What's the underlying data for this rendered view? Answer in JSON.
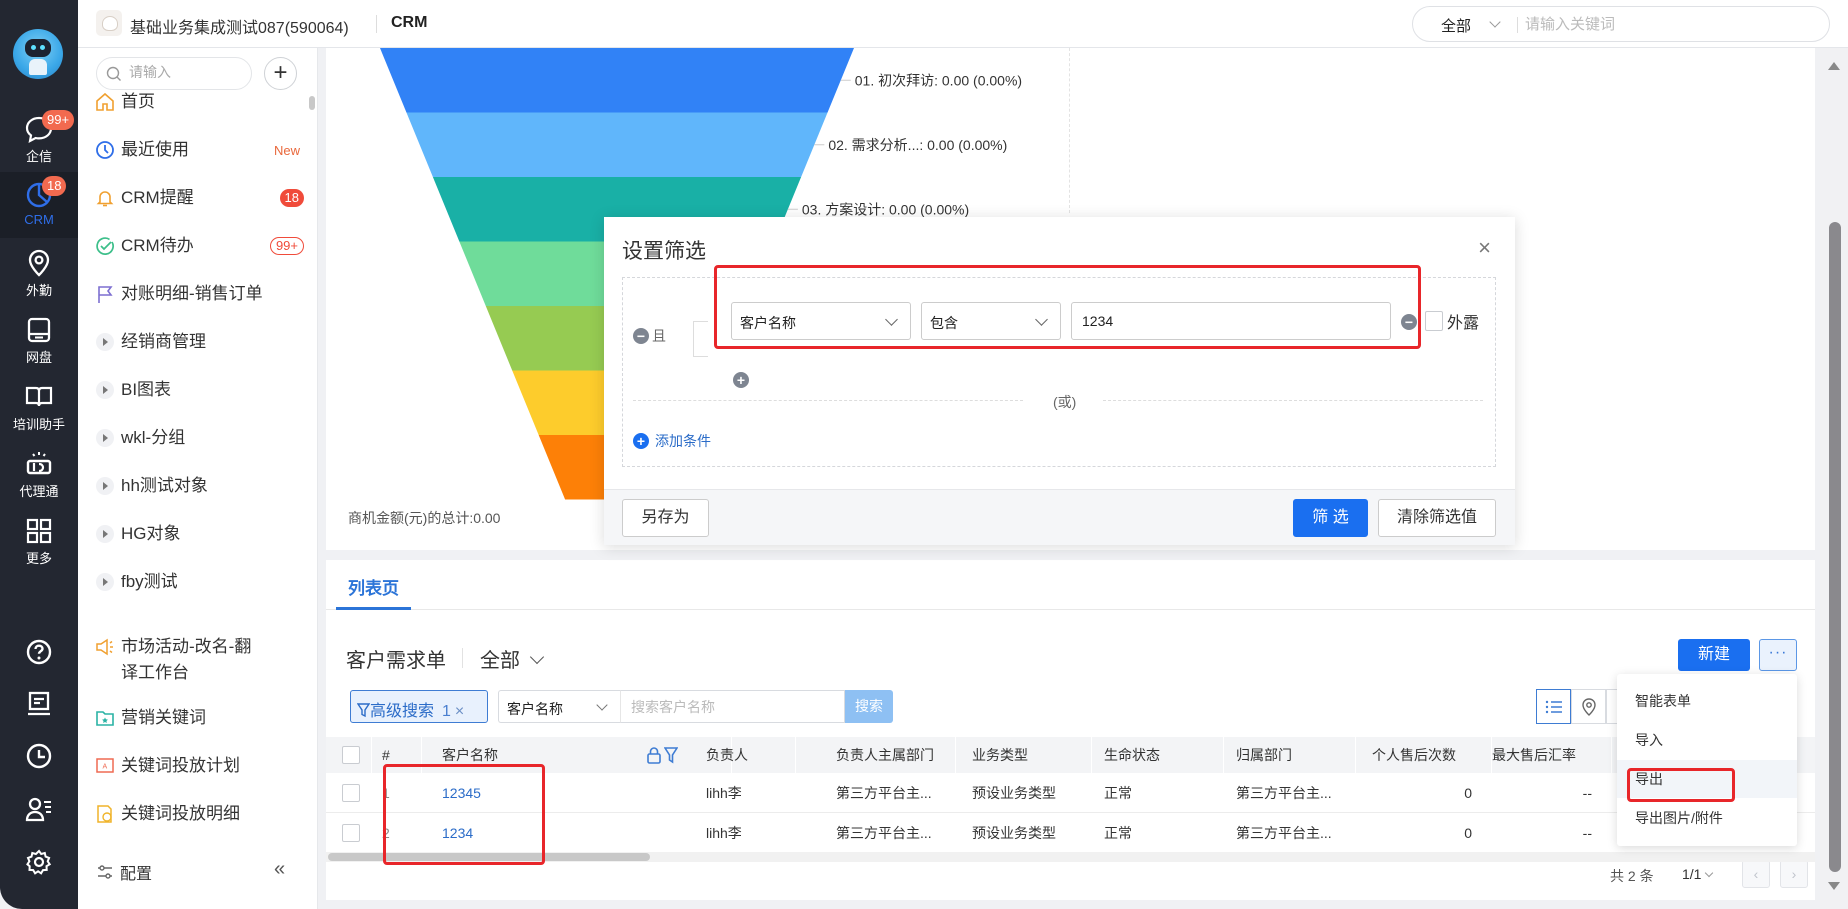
{
  "header": {
    "tenant": "基础业务集成测试087(590064)",
    "app": "CRM",
    "global_search": {
      "scope": "全部",
      "placeholder": "请输入关键词"
    }
  },
  "rail": {
    "items": [
      {
        "label": "企信",
        "icon": "chat-bubble-icon",
        "badge": "99+"
      },
      {
        "label": "CRM",
        "icon": "crm-pie-icon",
        "badge": "18",
        "active": true
      },
      {
        "label": "外勤",
        "icon": "location-pin-icon"
      },
      {
        "label": "网盘",
        "icon": "drive-icon"
      },
      {
        "label": "培训助手",
        "icon": "book-icon"
      },
      {
        "label": "代理通",
        "icon": "agent-icon"
      },
      {
        "label": "更多",
        "icon": "grid-icon"
      }
    ],
    "bottom": [
      "help-icon",
      "notes-icon",
      "clock-icon",
      "contacts-icon",
      "settings-icon"
    ]
  },
  "nav": {
    "search_placeholder": "请输入",
    "items": [
      {
        "label": "首页",
        "icon": "home-icon"
      },
      {
        "label": "最近使用",
        "icon": "recent-clock-icon",
        "tag": "New"
      },
      {
        "label": "CRM提醒",
        "icon": "bell-icon",
        "badge": "18"
      },
      {
        "label": "CRM待办",
        "icon": "check-circle-icon",
        "badge": "99+"
      },
      {
        "label": "对账明细-销售订单",
        "icon": "flag-icon"
      },
      {
        "label": "经销商管理",
        "icon": "expand-triangle-icon"
      },
      {
        "label": "BI图表",
        "icon": "expand-triangle-icon"
      },
      {
        "label": "wkl-分组",
        "icon": "expand-triangle-icon"
      },
      {
        "label": "hh测试对象",
        "icon": "expand-triangle-icon"
      },
      {
        "label": "HG对象",
        "icon": "expand-triangle-icon"
      },
      {
        "label": "fby测试",
        "icon": "expand-triangle-icon"
      },
      {
        "label": "市场活动-改名-翻译工作台",
        "icon": "megaphone-icon"
      },
      {
        "label": "营销关键词",
        "icon": "folder-star-icon"
      },
      {
        "label": "关键词投放计划",
        "icon": "ad-screen-icon"
      },
      {
        "label": "关键词投放明细",
        "icon": "ad-doc-icon"
      }
    ],
    "config_label": "配置"
  },
  "chart": {
    "total_label": "商机金额(元)的总计:0.00"
  },
  "chart_data": {
    "type": "funnel",
    "title": "",
    "stages": [
      {
        "label": "01. 初次拜访: 0.00 (0.00%)",
        "name": "初次拜访",
        "value": 0.0,
        "percent": 0.0,
        "color": "#3182f6"
      },
      {
        "label": "02. 需求分析...: 0.00 (0.00%)",
        "name": "需求分析...",
        "value": 0.0,
        "percent": 0.0,
        "color": "#60b6fb"
      },
      {
        "label": "03. 方案设计: 0.00 (0.00%)",
        "name": "方案设计",
        "value": 0.0,
        "percent": 0.0,
        "color": "#19b0a6"
      },
      {
        "label": "",
        "name": "",
        "value": null,
        "percent": null,
        "color": "#6fdc9a"
      },
      {
        "label": "",
        "name": "",
        "value": null,
        "percent": null,
        "color": "#96cb52"
      },
      {
        "label": "",
        "name": "",
        "value": null,
        "percent": null,
        "color": "#fdcc2c"
      },
      {
        "label": "",
        "name": "",
        "value": null,
        "percent": null,
        "color": "#fd8007"
      }
    ],
    "footer": "商机金额(元)的总计:0.00"
  },
  "list": {
    "tab": "列表页",
    "object_title": "客户需求单",
    "scope": "全部",
    "new_label": "新建",
    "more_label": "···",
    "adv_search": {
      "label": "高级搜索",
      "count": "1",
      "clear": "×"
    },
    "search_field": "客户名称",
    "search_placeholder": "搜索客户名称",
    "search_button": "搜索",
    "columns": [
      "#",
      "客户名称",
      "负责人",
      "负责人主属部门",
      "业务类型",
      "生命状态",
      "归属部门",
      "个人售后次数",
      "最大售后汇率"
    ],
    "rows": [
      {
        "idx": "1",
        "name": "12345",
        "owner": "lihh李",
        "owner_dept": "第三方平台主...",
        "biz_type": "预设业务类型",
        "status": "正常",
        "dept": "第三方平台主...",
        "aftersale_count": "0",
        "max_rate": "--"
      },
      {
        "idx": "2",
        "name": "1234",
        "owner": "lihh李",
        "owner_dept": "第三方平台主...",
        "biz_type": "预设业务类型",
        "status": "正常",
        "dept": "第三方平台主...",
        "aftersale_count": "0",
        "max_rate": "--"
      }
    ],
    "pager": {
      "total": "共 2 条",
      "page": "1/1",
      "prev": "‹",
      "next": "›"
    }
  },
  "more_menu": {
    "items": [
      "智能表单",
      "导入",
      "导出",
      "导出图片/附件"
    ],
    "highlighted": "导出"
  },
  "filter_dialog": {
    "title": "设置筛选",
    "close": "×",
    "and_label": "且",
    "field": "客户名称",
    "operator": "包含",
    "value": "1234",
    "expose_label": "外露",
    "or_label": "(或)",
    "add_condition": "添加条件",
    "save_as": "另存为",
    "apply": "筛 选",
    "clear": "清除筛选值"
  },
  "colors": {
    "primary": "#1a6ff0",
    "link": "#2b6cc8",
    "badge": "#f04b3a",
    "highlight": "#e8262a",
    "rail_bg": "#232731"
  }
}
